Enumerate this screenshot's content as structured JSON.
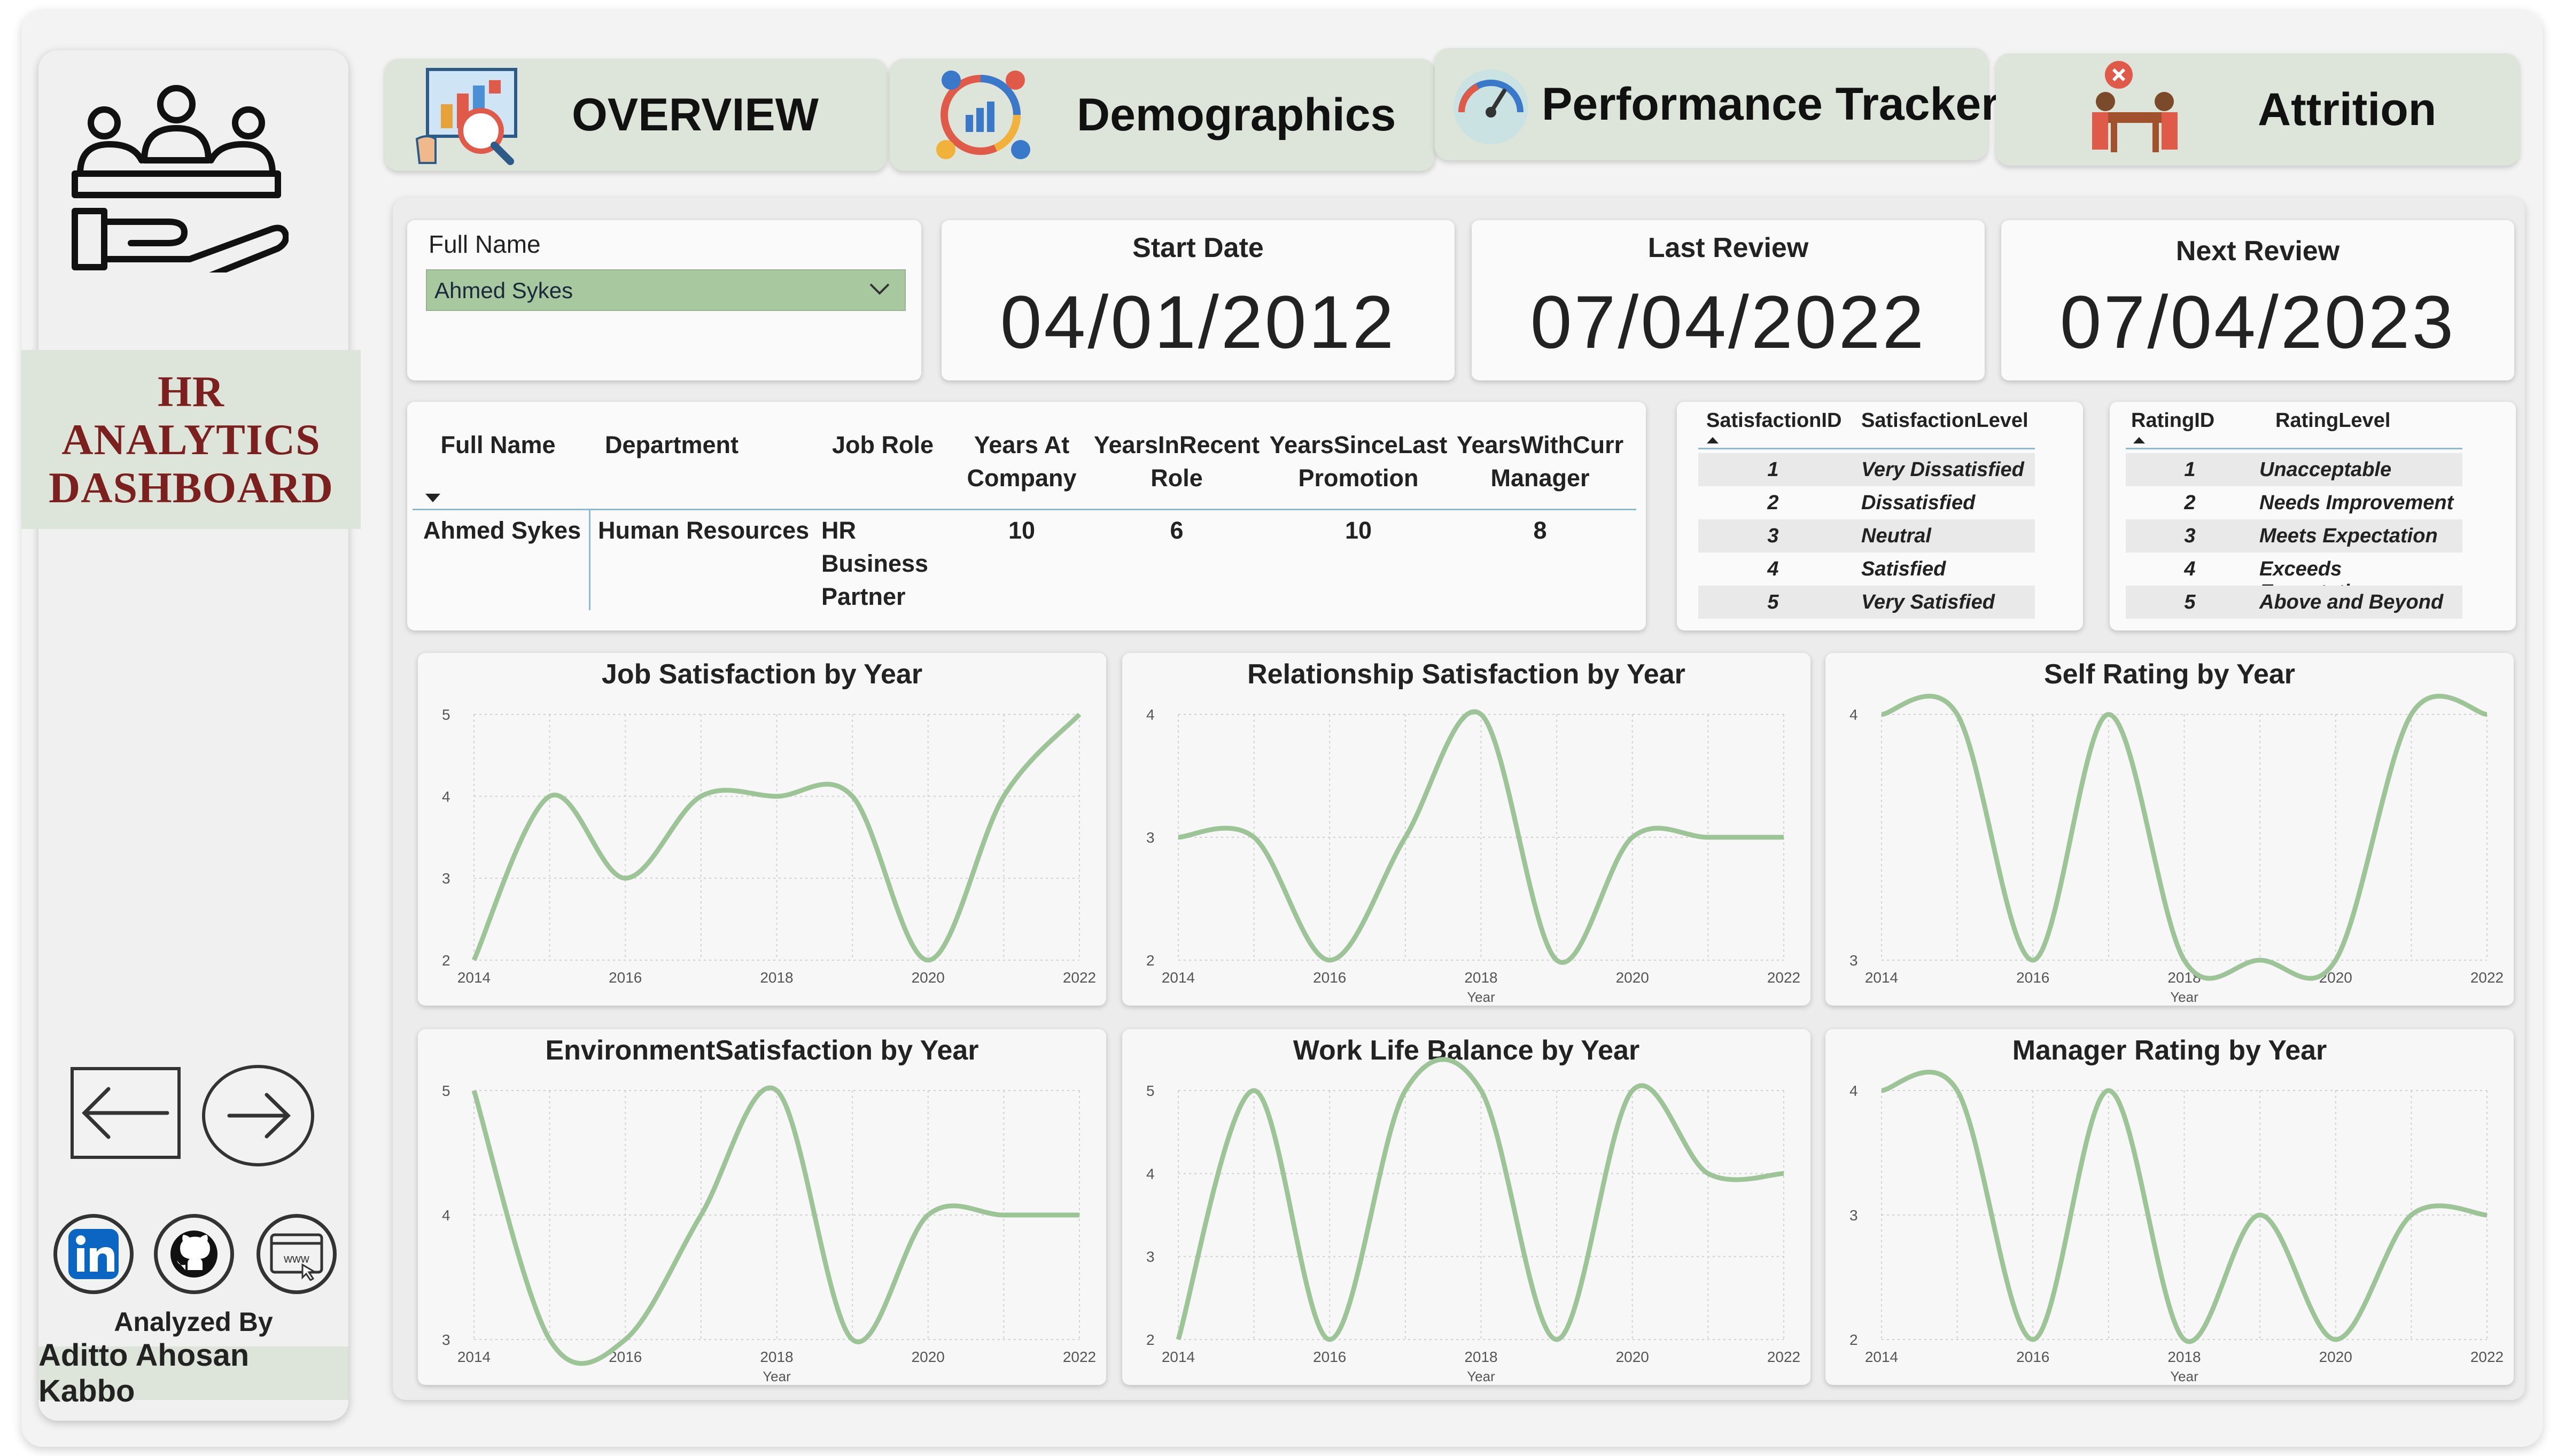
{
  "sidebar": {
    "title_lines": [
      "HR",
      "ANALYTICS",
      "DASHBOARD"
    ],
    "analyzed_by_label": "Analyzed By",
    "author": "Aditto Ahosan Kabbo",
    "social_icons": [
      "linkedin-icon",
      "github-icon",
      "website-icon"
    ]
  },
  "tabs": [
    {
      "label": "OVERVIEW",
      "icon": "presentation-chart-icon"
    },
    {
      "label": "Demographics",
      "icon": "people-chart-icon"
    },
    {
      "label": "Performance Tracker",
      "icon": "gauge-icon"
    },
    {
      "label": "Attrition",
      "icon": "meeting-leave-icon"
    }
  ],
  "filter": {
    "label": "Full Name",
    "selected": "Ahmed Sykes"
  },
  "dates": {
    "start": {
      "label": "Start Date",
      "value": "04/01/2012"
    },
    "last_review": {
      "label": "Last Review",
      "value": "07/04/2022"
    },
    "next_review": {
      "label": "Next Review",
      "value": "07/04/2023"
    }
  },
  "employee_table": {
    "headers": [
      [
        "Full Name"
      ],
      [
        "Department"
      ],
      [
        "Job Role"
      ],
      [
        "Years At",
        "Company"
      ],
      [
        "YearsInRecent",
        "Role"
      ],
      [
        "YearsSinceLast",
        "Promotion"
      ],
      [
        "YearsWithCurr",
        "Manager"
      ]
    ],
    "row": {
      "full_name": "Ahmed Sykes",
      "department": "Human Resources",
      "job_role": [
        "HR",
        "Business",
        "Partner"
      ],
      "years_at_company": "10",
      "years_in_recent_role": "6",
      "years_since_last_promotion": "10",
      "years_with_curr_manager": "8"
    }
  },
  "satisfaction_table": {
    "headers": [
      "SatisfactionID",
      "SatisfactionLevel"
    ],
    "rows": [
      [
        "1",
        "Very Dissatisfied"
      ],
      [
        "2",
        "Dissatisfied"
      ],
      [
        "3",
        "Neutral"
      ],
      [
        "4",
        "Satisfied"
      ],
      [
        "5",
        "Very Satisfied"
      ]
    ]
  },
  "rating_table": {
    "headers": [
      "RatingID",
      "RatingLevel"
    ],
    "rows": [
      [
        "1",
        "Unacceptable"
      ],
      [
        "2",
        "Needs Improvement"
      ],
      [
        "3",
        "Meets Expectation"
      ],
      [
        "4",
        "Exceeds Expectation"
      ],
      [
        "5",
        "Above and Beyond"
      ]
    ]
  },
  "colors": {
    "line": "#9cc497",
    "accent_green": "#dde5da",
    "title_red": "#7b1f1f"
  },
  "chart_data": [
    {
      "type": "line",
      "title": "Job Satisfaction by Year",
      "xlabel": "",
      "x": [
        2014,
        2015,
        2016,
        2017,
        2018,
        2019,
        2020,
        2021,
        2022
      ],
      "values": [
        2,
        4,
        3,
        4,
        4,
        4,
        2,
        4,
        5
      ],
      "xticks": [
        "2014",
        "2016",
        "2018",
        "2020",
        "2022"
      ],
      "yticks": [
        "2",
        "3",
        "4",
        "5"
      ],
      "ylim": [
        2,
        5
      ]
    },
    {
      "type": "line",
      "title": "Relationship Satisfaction by Year",
      "xlabel": "Year",
      "x": [
        2014,
        2015,
        2016,
        2017,
        2018,
        2019,
        2020,
        2021,
        2022
      ],
      "values": [
        3,
        3,
        2,
        3,
        4,
        2,
        3,
        3,
        3
      ],
      "xticks": [
        "2014",
        "2016",
        "2018",
        "2020",
        "2022"
      ],
      "yticks": [
        "2",
        "3",
        "4"
      ],
      "ylim": [
        2,
        4
      ]
    },
    {
      "type": "line",
      "title": "Self Rating by Year",
      "xlabel": "Year",
      "x": [
        2014,
        2015,
        2016,
        2017,
        2018,
        2019,
        2020,
        2021,
        2022
      ],
      "values": [
        4,
        4,
        3,
        4,
        3,
        3,
        3,
        4,
        4
      ],
      "xticks": [
        "2014",
        "2016",
        "2018",
        "2020",
        "2022"
      ],
      "yticks": [
        "3",
        "4"
      ],
      "ylim": [
        3,
        4
      ]
    },
    {
      "type": "line",
      "title": "EnvironmentSatisfaction by Year",
      "xlabel": "Year",
      "x": [
        2014,
        2015,
        2016,
        2017,
        2018,
        2019,
        2020,
        2021,
        2022
      ],
      "values": [
        5,
        3,
        3,
        4,
        5,
        3,
        4,
        4,
        4
      ],
      "xticks": [
        "2014",
        "2016",
        "2018",
        "2020",
        "2022"
      ],
      "yticks": [
        "3",
        "4",
        "5"
      ],
      "ylim": [
        3,
        5
      ]
    },
    {
      "type": "line",
      "title": "Work Life Balance by Year",
      "xlabel": "Year",
      "x": [
        2014,
        2015,
        2016,
        2017,
        2018,
        2019,
        2020,
        2021,
        2022
      ],
      "values": [
        2,
        5,
        2,
        5,
        5,
        2,
        5,
        4,
        4
      ],
      "xticks": [
        "2014",
        "2016",
        "2018",
        "2020",
        "2022"
      ],
      "yticks": [
        "2",
        "3",
        "4",
        "5"
      ],
      "ylim": [
        2,
        5
      ]
    },
    {
      "type": "line",
      "title": "Manager Rating by Year",
      "xlabel": "Year",
      "x": [
        2014,
        2015,
        2016,
        2017,
        2018,
        2019,
        2020,
        2021,
        2022
      ],
      "values": [
        4,
        4,
        2,
        4,
        2,
        3,
        2,
        3,
        3
      ],
      "xticks": [
        "2014",
        "2016",
        "2018",
        "2020",
        "2022"
      ],
      "yticks": [
        "2",
        "3",
        "4"
      ],
      "ylim": [
        2,
        4
      ]
    }
  ]
}
